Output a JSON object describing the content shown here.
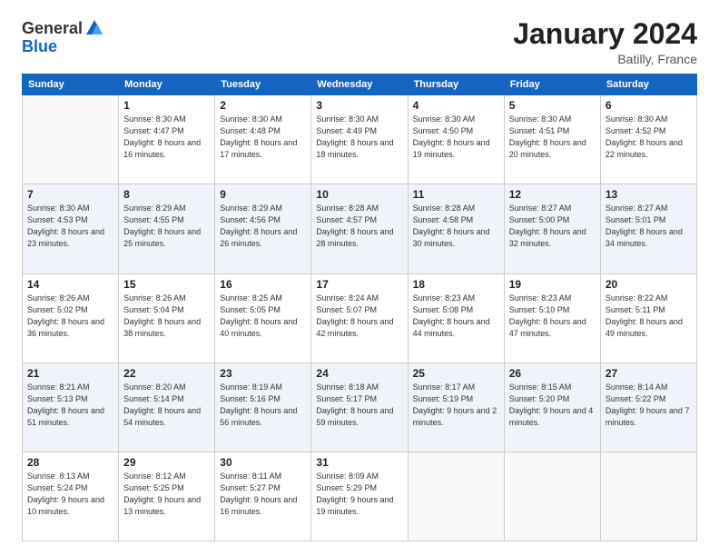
{
  "logo": {
    "general": "General",
    "blue": "Blue"
  },
  "title": "January 2024",
  "location": "Batilly, France",
  "days_header": [
    "Sunday",
    "Monday",
    "Tuesday",
    "Wednesday",
    "Thursday",
    "Friday",
    "Saturday"
  ],
  "weeks": [
    [
      {
        "day": "",
        "sunrise": "",
        "sunset": "",
        "daylight": ""
      },
      {
        "day": "1",
        "sunrise": "Sunrise: 8:30 AM",
        "sunset": "Sunset: 4:47 PM",
        "daylight": "Daylight: 8 hours and 16 minutes."
      },
      {
        "day": "2",
        "sunrise": "Sunrise: 8:30 AM",
        "sunset": "Sunset: 4:48 PM",
        "daylight": "Daylight: 8 hours and 17 minutes."
      },
      {
        "day": "3",
        "sunrise": "Sunrise: 8:30 AM",
        "sunset": "Sunset: 4:49 PM",
        "daylight": "Daylight: 8 hours and 18 minutes."
      },
      {
        "day": "4",
        "sunrise": "Sunrise: 8:30 AM",
        "sunset": "Sunset: 4:50 PM",
        "daylight": "Daylight: 8 hours and 19 minutes."
      },
      {
        "day": "5",
        "sunrise": "Sunrise: 8:30 AM",
        "sunset": "Sunset: 4:51 PM",
        "daylight": "Daylight: 8 hours and 20 minutes."
      },
      {
        "day": "6",
        "sunrise": "Sunrise: 8:30 AM",
        "sunset": "Sunset: 4:52 PM",
        "daylight": "Daylight: 8 hours and 22 minutes."
      }
    ],
    [
      {
        "day": "7",
        "sunrise": "Sunrise: 8:30 AM",
        "sunset": "Sunset: 4:53 PM",
        "daylight": "Daylight: 8 hours and 23 minutes."
      },
      {
        "day": "8",
        "sunrise": "Sunrise: 8:29 AM",
        "sunset": "Sunset: 4:55 PM",
        "daylight": "Daylight: 8 hours and 25 minutes."
      },
      {
        "day": "9",
        "sunrise": "Sunrise: 8:29 AM",
        "sunset": "Sunset: 4:56 PM",
        "daylight": "Daylight: 8 hours and 26 minutes."
      },
      {
        "day": "10",
        "sunrise": "Sunrise: 8:28 AM",
        "sunset": "Sunset: 4:57 PM",
        "daylight": "Daylight: 8 hours and 28 minutes."
      },
      {
        "day": "11",
        "sunrise": "Sunrise: 8:28 AM",
        "sunset": "Sunset: 4:58 PM",
        "daylight": "Daylight: 8 hours and 30 minutes."
      },
      {
        "day": "12",
        "sunrise": "Sunrise: 8:27 AM",
        "sunset": "Sunset: 5:00 PM",
        "daylight": "Daylight: 8 hours and 32 minutes."
      },
      {
        "day": "13",
        "sunrise": "Sunrise: 8:27 AM",
        "sunset": "Sunset: 5:01 PM",
        "daylight": "Daylight: 8 hours and 34 minutes."
      }
    ],
    [
      {
        "day": "14",
        "sunrise": "Sunrise: 8:26 AM",
        "sunset": "Sunset: 5:02 PM",
        "daylight": "Daylight: 8 hours and 36 minutes."
      },
      {
        "day": "15",
        "sunrise": "Sunrise: 8:26 AM",
        "sunset": "Sunset: 5:04 PM",
        "daylight": "Daylight: 8 hours and 38 minutes."
      },
      {
        "day": "16",
        "sunrise": "Sunrise: 8:25 AM",
        "sunset": "Sunset: 5:05 PM",
        "daylight": "Daylight: 8 hours and 40 minutes."
      },
      {
        "day": "17",
        "sunrise": "Sunrise: 8:24 AM",
        "sunset": "Sunset: 5:07 PM",
        "daylight": "Daylight: 8 hours and 42 minutes."
      },
      {
        "day": "18",
        "sunrise": "Sunrise: 8:23 AM",
        "sunset": "Sunset: 5:08 PM",
        "daylight": "Daylight: 8 hours and 44 minutes."
      },
      {
        "day": "19",
        "sunrise": "Sunrise: 8:23 AM",
        "sunset": "Sunset: 5:10 PM",
        "daylight": "Daylight: 8 hours and 47 minutes."
      },
      {
        "day": "20",
        "sunrise": "Sunrise: 8:22 AM",
        "sunset": "Sunset: 5:11 PM",
        "daylight": "Daylight: 8 hours and 49 minutes."
      }
    ],
    [
      {
        "day": "21",
        "sunrise": "Sunrise: 8:21 AM",
        "sunset": "Sunset: 5:13 PM",
        "daylight": "Daylight: 8 hours and 51 minutes."
      },
      {
        "day": "22",
        "sunrise": "Sunrise: 8:20 AM",
        "sunset": "Sunset: 5:14 PM",
        "daylight": "Daylight: 8 hours and 54 minutes."
      },
      {
        "day": "23",
        "sunrise": "Sunrise: 8:19 AM",
        "sunset": "Sunset: 5:16 PM",
        "daylight": "Daylight: 8 hours and 56 minutes."
      },
      {
        "day": "24",
        "sunrise": "Sunrise: 8:18 AM",
        "sunset": "Sunset: 5:17 PM",
        "daylight": "Daylight: 8 hours and 59 minutes."
      },
      {
        "day": "25",
        "sunrise": "Sunrise: 8:17 AM",
        "sunset": "Sunset: 5:19 PM",
        "daylight": "Daylight: 9 hours and 2 minutes."
      },
      {
        "day": "26",
        "sunrise": "Sunrise: 8:15 AM",
        "sunset": "Sunset: 5:20 PM",
        "daylight": "Daylight: 9 hours and 4 minutes."
      },
      {
        "day": "27",
        "sunrise": "Sunrise: 8:14 AM",
        "sunset": "Sunset: 5:22 PM",
        "daylight": "Daylight: 9 hours and 7 minutes."
      }
    ],
    [
      {
        "day": "28",
        "sunrise": "Sunrise: 8:13 AM",
        "sunset": "Sunset: 5:24 PM",
        "daylight": "Daylight: 9 hours and 10 minutes."
      },
      {
        "day": "29",
        "sunrise": "Sunrise: 8:12 AM",
        "sunset": "Sunset: 5:25 PM",
        "daylight": "Daylight: 9 hours and 13 minutes."
      },
      {
        "day": "30",
        "sunrise": "Sunrise: 8:11 AM",
        "sunset": "Sunset: 5:27 PM",
        "daylight": "Daylight: 9 hours and 16 minutes."
      },
      {
        "day": "31",
        "sunrise": "Sunrise: 8:09 AM",
        "sunset": "Sunset: 5:29 PM",
        "daylight": "Daylight: 9 hours and 19 minutes."
      },
      {
        "day": "",
        "sunrise": "",
        "sunset": "",
        "daylight": ""
      },
      {
        "day": "",
        "sunrise": "",
        "sunset": "",
        "daylight": ""
      },
      {
        "day": "",
        "sunrise": "",
        "sunset": "",
        "daylight": ""
      }
    ]
  ]
}
